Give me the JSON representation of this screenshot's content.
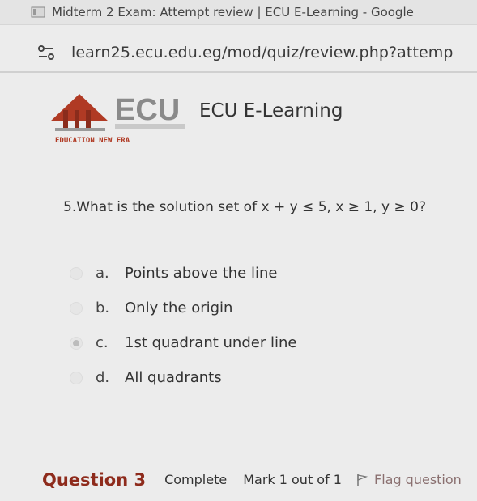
{
  "browser": {
    "window_title": "Midterm 2 Exam: Attempt review | ECU E-Learning - Google",
    "url": "learn25.ecu.edu.eg/mod/quiz/review.php?attemp"
  },
  "header": {
    "logo_text": "ECU",
    "logo_tagline": "EDUCATION NEW ERA",
    "site_name": "ECU E-Learning"
  },
  "question": {
    "text": "5.What is the solution set of x + y ≤ 5, x ≥ 1, y ≥ 0?",
    "answers": [
      {
        "letter": "a.",
        "text": "Points above the line",
        "selected": false
      },
      {
        "letter": "b.",
        "text": "Only the origin",
        "selected": false
      },
      {
        "letter": "c.",
        "text": "1st quadrant under line",
        "selected": true
      },
      {
        "letter": "d.",
        "text": "All quadrants",
        "selected": false
      }
    ]
  },
  "question_info": {
    "title": "Question 3",
    "state": "Complete",
    "mark": "Mark 1 out of 1",
    "flag_label": "Flag question"
  },
  "colors": {
    "logo_red": "#b03a24",
    "logo_gray": "#8a8a8a",
    "question_title": "#8e2b1c"
  }
}
